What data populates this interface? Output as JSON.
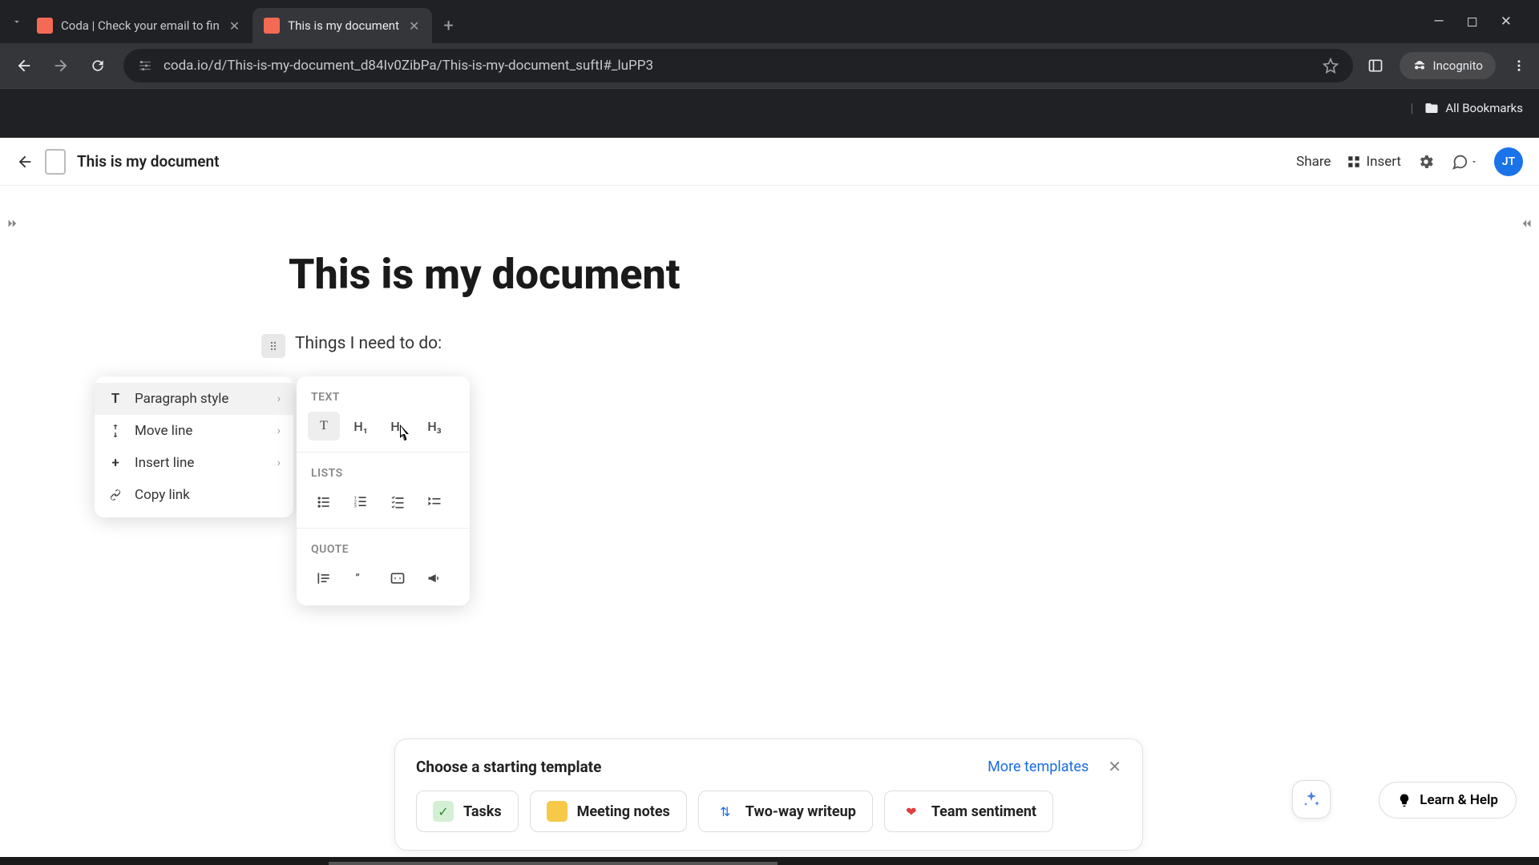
{
  "browser": {
    "tabs": [
      {
        "title": "Coda | Check your email to fin"
      },
      {
        "title": "This is my document"
      }
    ],
    "url": "coda.io/d/This-is-my-document_d84Iv0ZibPa/This-is-my-document_suftI#_luPP3",
    "incognito_label": "Incognito",
    "bookmarks_label": "All Bookmarks"
  },
  "app_header": {
    "doc_title": "This is my document",
    "share": "Share",
    "insert": "Insert",
    "avatar": "JT"
  },
  "doc": {
    "title": "This is my document",
    "line1": "Things I need to do:"
  },
  "context_menu": {
    "items": [
      {
        "label": "Paragraph style"
      },
      {
        "label": "Move line"
      },
      {
        "label": "Insert line"
      },
      {
        "label": "Copy link"
      }
    ]
  },
  "submenu": {
    "section_text": "TEXT",
    "section_lists": "LISTS",
    "section_quote": "QUOTE",
    "text_options": {
      "t": "T",
      "h1": "H₁",
      "h2": "H₂",
      "h3": "H₃"
    }
  },
  "template_card": {
    "title": "Choose a starting template",
    "more": "More templates",
    "options": [
      {
        "label": "Tasks",
        "bg": "#d4f0d4",
        "glyph": "✓",
        "glyph_color": "#2e8b2e"
      },
      {
        "label": "Meeting notes",
        "bg": "#f6c949",
        "glyph": "",
        "glyph_color": "#333"
      },
      {
        "label": "Two-way writeup",
        "bg": "#ffffff",
        "glyph": "⇅",
        "glyph_color": "#1a6dde"
      },
      {
        "label": "Team sentiment",
        "bg": "#ffffff",
        "glyph": "❤",
        "glyph_color": "#e23b3b"
      }
    ]
  },
  "learn_help": "Learn & Help"
}
